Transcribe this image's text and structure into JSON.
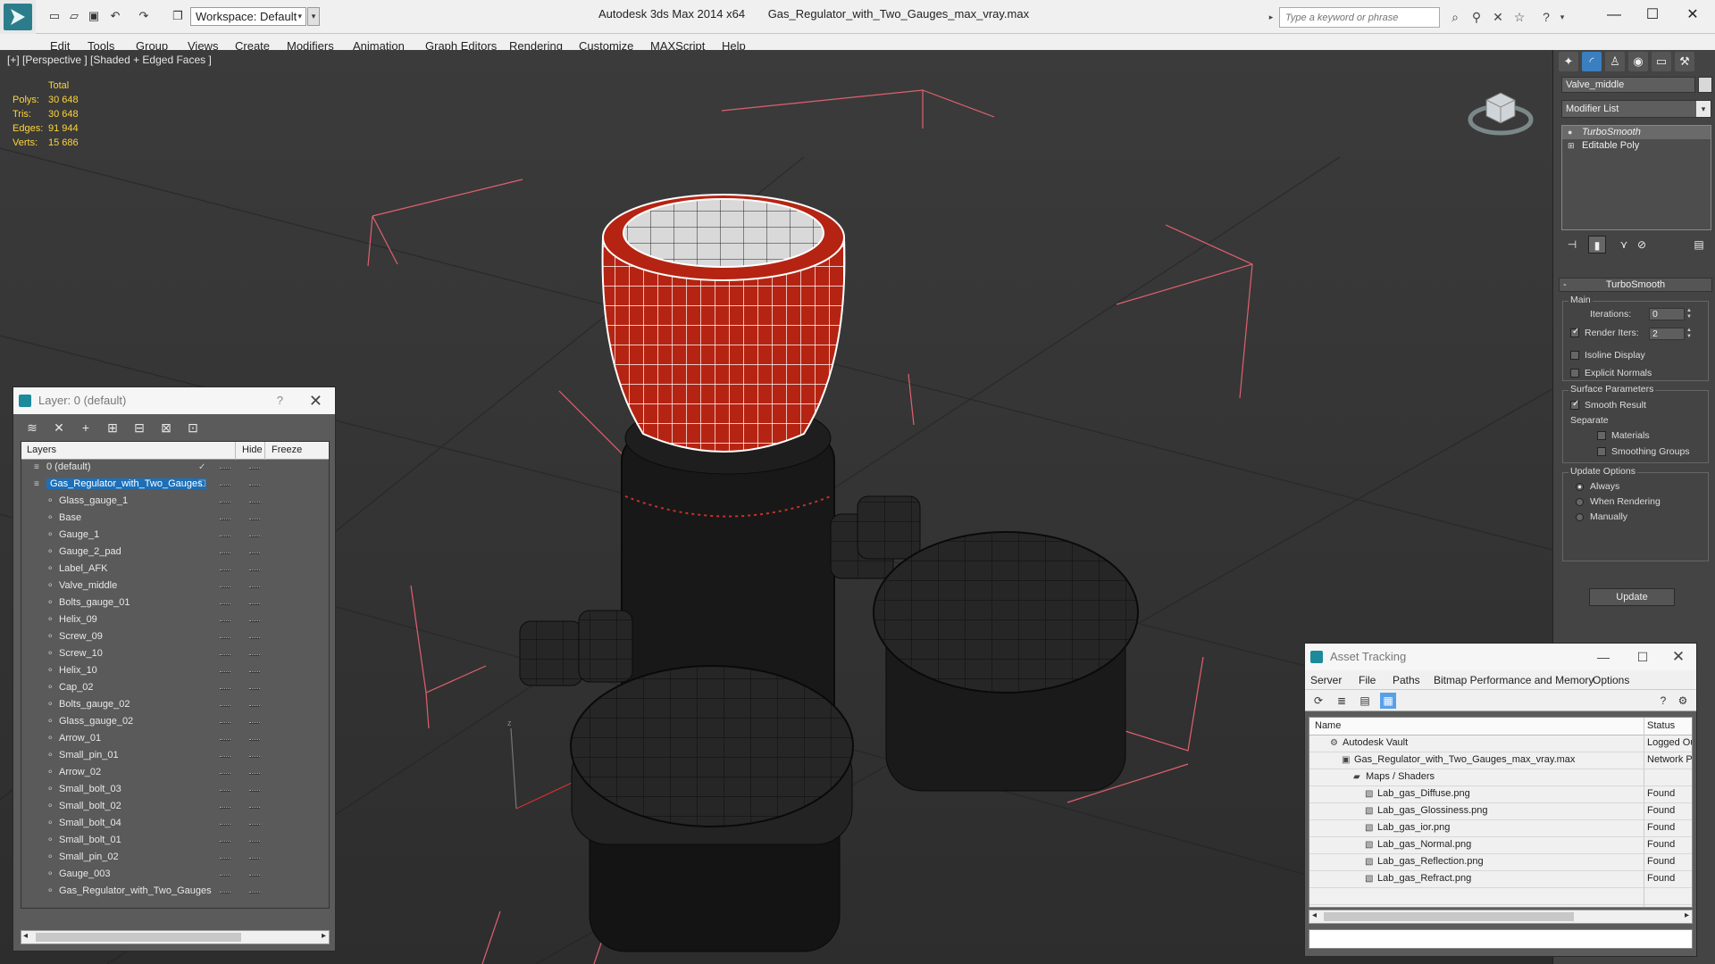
{
  "titlebar": {
    "workspace": "Workspace: Default",
    "app_name": "Autodesk 3ds Max  2014 x64",
    "file_name": "Gas_Regulator_with_Two_Gauges_max_vray.max",
    "search_placeholder": "Type a keyword or phrase"
  },
  "menu": [
    "Edit",
    "Tools",
    "Group",
    "Views",
    "Create",
    "Modifiers",
    "Animation",
    "Graph Editors",
    "Rendering",
    "Customize",
    "MAXScript",
    "Help"
  ],
  "viewport": {
    "label": "[+] [Perspective ] [Shaded + Edged Faces ]",
    "stats": {
      "header": "Total",
      "rows": [
        {
          "key": "Polys:",
          "value": "30 648"
        },
        {
          "key": "Tris:",
          "value": "30 648"
        },
        {
          "key": "Edges:",
          "value": "91 944"
        },
        {
          "key": "Verts:",
          "value": "15 686"
        }
      ]
    }
  },
  "layer_panel": {
    "title": "Layer: 0 (default)",
    "help": "?",
    "columns": {
      "layers": "Layers",
      "hide": "Hide",
      "freeze": "Freeze"
    },
    "rows": [
      {
        "name": "0 (default)",
        "level": 0,
        "type": "layer"
      },
      {
        "name": "Gas_Regulator_with_Two_Gauges",
        "level": 0,
        "type": "layer",
        "selected": true
      },
      {
        "name": "Glass_gauge_1",
        "level": 1,
        "type": "object"
      },
      {
        "name": "Base",
        "level": 1,
        "type": "object"
      },
      {
        "name": "Gauge_1",
        "level": 1,
        "type": "object"
      },
      {
        "name": "Gauge_2_pad",
        "level": 1,
        "type": "object"
      },
      {
        "name": "Label_AFK",
        "level": 1,
        "type": "object"
      },
      {
        "name": "Valve_middle",
        "level": 1,
        "type": "object"
      },
      {
        "name": "Bolts_gauge_01",
        "level": 1,
        "type": "object"
      },
      {
        "name": "Helix_09",
        "level": 1,
        "type": "object"
      },
      {
        "name": "Screw_09",
        "level": 1,
        "type": "object"
      },
      {
        "name": "Screw_10",
        "level": 1,
        "type": "object"
      },
      {
        "name": "Helix_10",
        "level": 1,
        "type": "object"
      },
      {
        "name": "Cap_02",
        "level": 1,
        "type": "object"
      },
      {
        "name": "Bolts_gauge_02",
        "level": 1,
        "type": "object"
      },
      {
        "name": "Glass_gauge_02",
        "level": 1,
        "type": "object"
      },
      {
        "name": "Arrow_01",
        "level": 1,
        "type": "object"
      },
      {
        "name": "Small_pin_01",
        "level": 1,
        "type": "object"
      },
      {
        "name": "Arrow_02",
        "level": 1,
        "type": "object"
      },
      {
        "name": "Small_bolt_03",
        "level": 1,
        "type": "object"
      },
      {
        "name": "Small_bolt_02",
        "level": 1,
        "type": "object"
      },
      {
        "name": "Small_bolt_04",
        "level": 1,
        "type": "object"
      },
      {
        "name": "Small_bolt_01",
        "level": 1,
        "type": "object"
      },
      {
        "name": "Small_pin_02",
        "level": 1,
        "type": "object"
      },
      {
        "name": "Gauge_003",
        "level": 1,
        "type": "object"
      },
      {
        "name": "Gas_Regulator_with_Two_Gauges",
        "level": 1,
        "type": "object"
      }
    ]
  },
  "command_panel": {
    "object_name": "Valve_middle",
    "modifier_list": "Modifier List",
    "stack": [
      {
        "name": "TurboSmooth",
        "active": true
      },
      {
        "name": "Editable Poly",
        "active": false
      }
    ],
    "rollout": {
      "title": "TurboSmooth",
      "main_label": "Main",
      "iterations_label": "Iterations:",
      "iterations_value": "0",
      "render_iters_label": "Render Iters:",
      "render_iters_value": "2",
      "isoline_label": "Isoline Display",
      "explicit_label": "Explicit Normals",
      "surface_label": "Surface Parameters",
      "smooth_result_label": "Smooth Result",
      "separate_label": "Separate",
      "materials_label": "Materials",
      "smoothing_groups_label": "Smoothing Groups",
      "update_options_label": "Update Options",
      "always_label": "Always",
      "when_rendering_label": "When Rendering",
      "manually_label": "Manually",
      "update_button": "Update"
    }
  },
  "asset_panel": {
    "title": "Asset Tracking",
    "menu": [
      "Server",
      "File",
      "Paths",
      "Bitmap Performance and Memory",
      "Options"
    ],
    "columns": {
      "name": "Name",
      "status": "Status"
    },
    "rows": [
      {
        "name": "Autodesk Vault",
        "status": "Logged Ou",
        "level": 1,
        "icon": "vault"
      },
      {
        "name": "Gas_Regulator_with_Two_Gauges_max_vray.max",
        "status": "Network P",
        "level": 2,
        "icon": "max"
      },
      {
        "name": "Maps / Shaders",
        "status": "",
        "level": 3,
        "icon": "folder"
      },
      {
        "name": "Lab_gas_Diffuse.png",
        "status": "Found",
        "level": 4,
        "icon": "image"
      },
      {
        "name": "Lab_gas_Glossiness.png",
        "status": "Found",
        "level": 4,
        "icon": "image"
      },
      {
        "name": "Lab_gas_ior.png",
        "status": "Found",
        "level": 4,
        "icon": "image"
      },
      {
        "name": "Lab_gas_Normal.png",
        "status": "Found",
        "level": 4,
        "icon": "image"
      },
      {
        "name": "Lab_gas_Reflection.png",
        "status": "Found",
        "level": 4,
        "icon": "image"
      },
      {
        "name": "Lab_gas_Refract.png",
        "status": "Found",
        "level": 4,
        "icon": "image"
      }
    ]
  }
}
